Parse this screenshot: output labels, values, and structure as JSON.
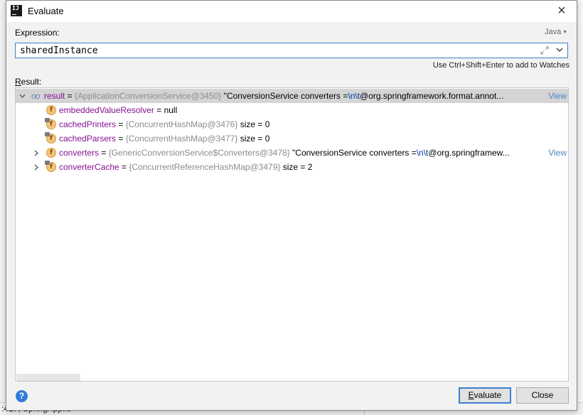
{
  "dialog": {
    "title": "Evaluate",
    "close_glyph": "×",
    "app_icon_text": "IJ"
  },
  "expression": {
    "label": "Expression:",
    "language": "Java",
    "value": "sharedInstance",
    "hint": "Use Ctrl+Shift+Enter to add to Watches"
  },
  "result": {
    "label_mnemonic": "R",
    "label_rest": "esult:",
    "view_label": "View",
    "rows": [
      {
        "name": "result",
        "eq": " = ",
        "ref": "{ApplicationConversionService@3450}",
        "str_before": " \"ConversionService converters =",
        "esc": "\\n\\t",
        "str_after": "@org.springframework.format.annot...",
        "has_view": true,
        "expandable": true,
        "expanded": true,
        "icon": "watch-oo-icon"
      },
      {
        "name": "embeddedValueResolver",
        "eq": " = ",
        "plain": "null",
        "expandable": false,
        "icon": "field-icon",
        "locked": false
      },
      {
        "name": "cachedPrinters",
        "eq": " = ",
        "ref": "{ConcurrentHashMap@3476}",
        "plain": "  size = 0",
        "expandable": false,
        "icon": "field-icon",
        "locked": true
      },
      {
        "name": "cachedParsers",
        "eq": " = ",
        "ref": "{ConcurrentHashMap@3477}",
        "plain": "  size = 0",
        "expandable": false,
        "icon": "field-icon",
        "locked": true
      },
      {
        "name": "converters",
        "eq": " = ",
        "ref": "{GenericConversionService$Converters@3478}",
        "str_before": " \"ConversionService converters =",
        "esc": "\\n\\t",
        "str_after": "@org.springframew...",
        "has_view": true,
        "expandable": true,
        "expanded": false,
        "icon": "field-icon",
        "locked": false
      },
      {
        "name": "converterCache",
        "eq": " = ",
        "ref": "{ConcurrentReferenceHashMap@3479}",
        "plain": "  size = 2",
        "expandable": true,
        "expanded": false,
        "icon": "field-icon",
        "locked": true
      }
    ]
  },
  "buttons": {
    "evaluate_mnemonic": "E",
    "evaluate_rest": "valuate",
    "close": "Close",
    "help": "?"
  },
  "background": {
    "bottom_text": ":417, SpringApplic"
  },
  "colors": {
    "field_name": "#871094",
    "reference": "#8c8c8c",
    "escape": "#0037a6",
    "link": "#4a86c8",
    "accent": "#3d7fd1",
    "selection": "#d4d4d4"
  }
}
